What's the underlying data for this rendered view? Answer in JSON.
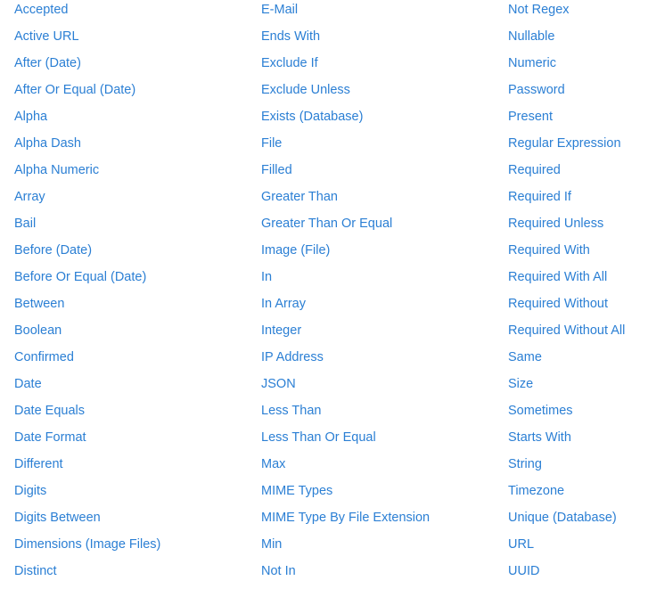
{
  "link_color": "#2b7fd4",
  "columns": [
    [
      "Accepted",
      "Active URL",
      "After (Date)",
      "After Or Equal (Date)",
      "Alpha",
      "Alpha Dash",
      "Alpha Numeric",
      "Array",
      "Bail",
      "Before (Date)",
      "Before Or Equal (Date)",
      "Between",
      "Boolean",
      "Confirmed",
      "Date",
      "Date Equals",
      "Date Format",
      "Different",
      "Digits",
      "Digits Between",
      "Dimensions (Image Files)",
      "Distinct"
    ],
    [
      "E-Mail",
      "Ends With",
      "Exclude If",
      "Exclude Unless",
      "Exists (Database)",
      "File",
      "Filled",
      "Greater Than",
      "Greater Than Or Equal",
      "Image (File)",
      "In",
      "In Array",
      "Integer",
      "IP Address",
      "JSON",
      "Less Than",
      "Less Than Or Equal",
      "Max",
      "MIME Types",
      "MIME Type By File Extension",
      "Min",
      "Not In"
    ],
    [
      "Not Regex",
      "Nullable",
      "Numeric",
      "Password",
      "Present",
      "Regular Expression",
      "Required",
      "Required If",
      "Required Unless",
      "Required With",
      "Required With All",
      "Required Without",
      "Required Without All",
      "Same",
      "Size",
      "Sometimes",
      "Starts With",
      "String",
      "Timezone",
      "Unique (Database)",
      "URL",
      "UUID"
    ]
  ]
}
